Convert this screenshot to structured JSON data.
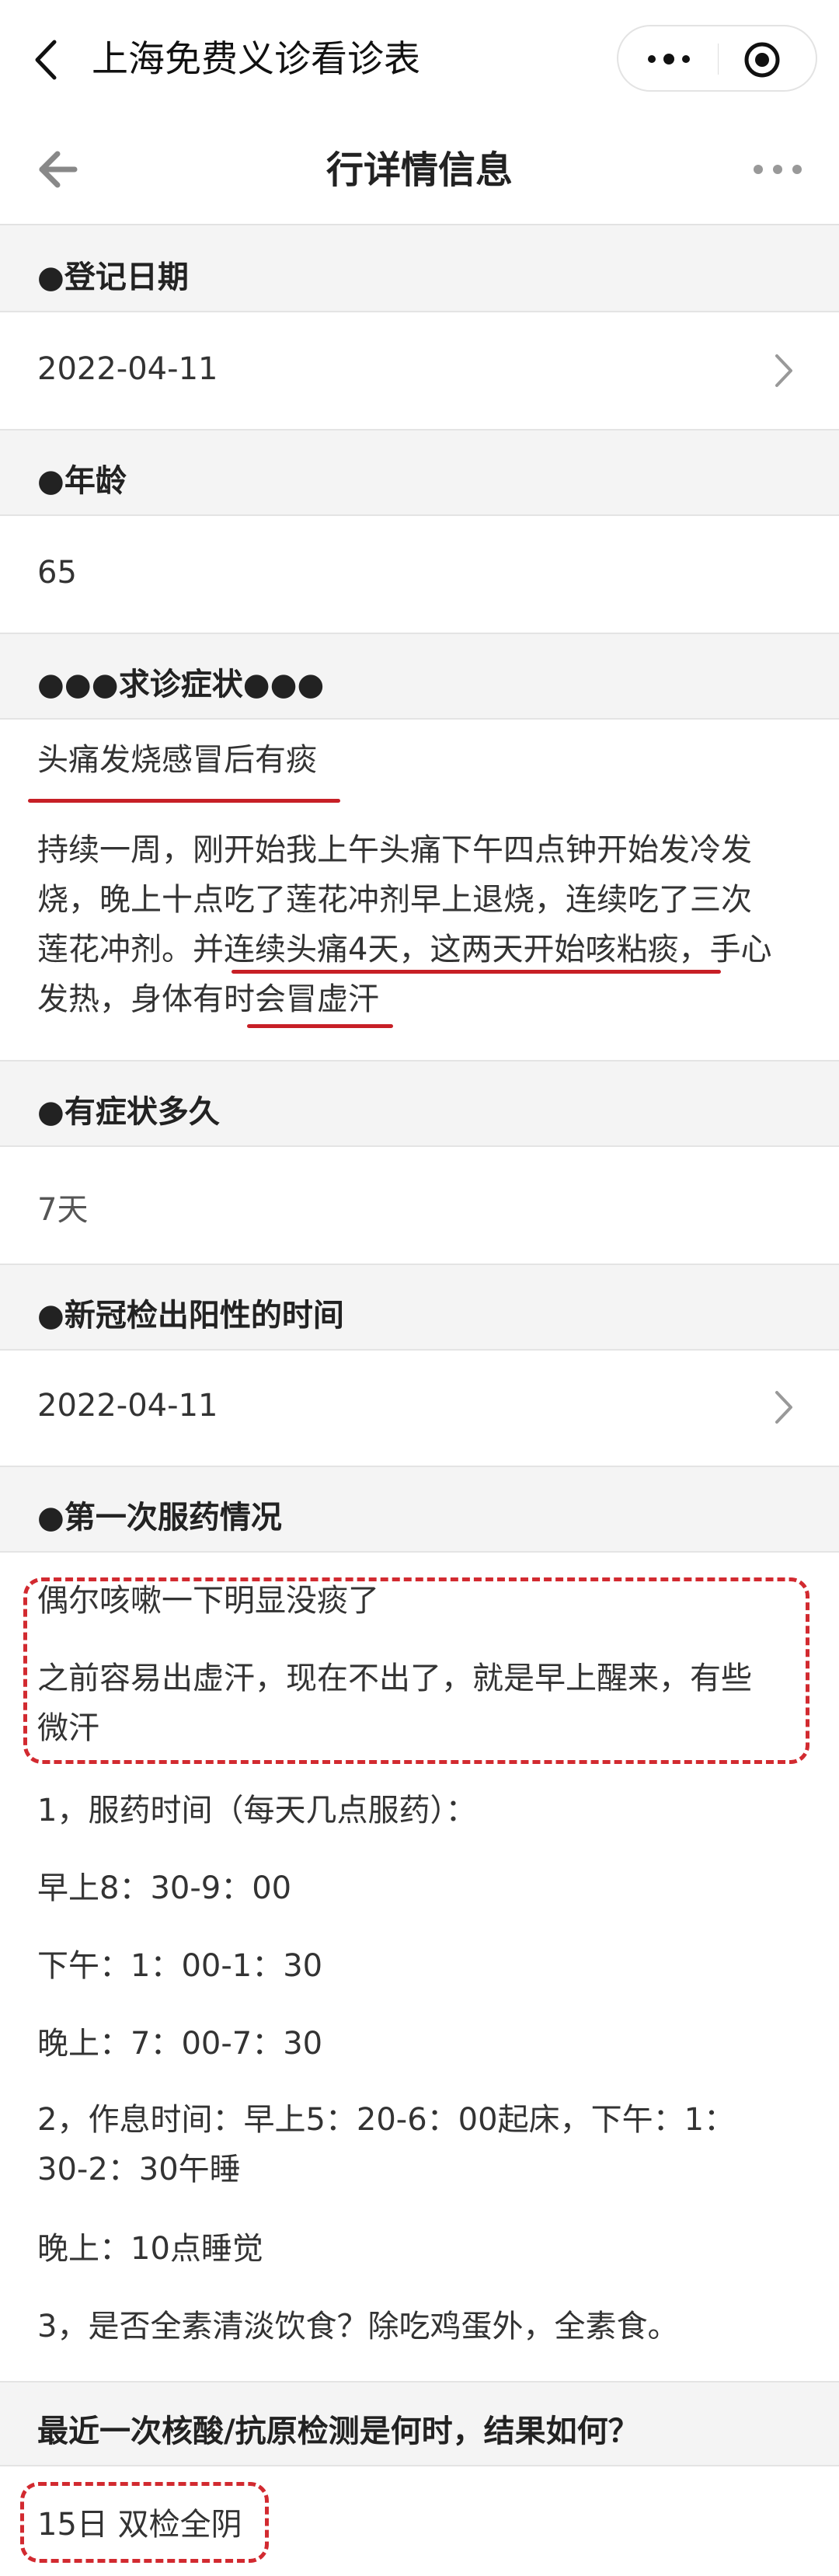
{
  "app": {
    "title": "上海免费义诊看诊表"
  },
  "page": {
    "title": "行详情信息"
  },
  "sections": {
    "reg_date": {
      "label": "●登记日期",
      "value": "2022-04-11"
    },
    "age": {
      "label": "●年龄",
      "value": "65"
    },
    "symptom": {
      "label": "●●●求诊症状●●●",
      "headline": "头痛发烧感冒后有痰",
      "p1": "持续一周，刚开始我上午头痛下午四点钟开始发冷发",
      "p2": "烧，晚上十点吃了莲花冲剂早上退烧，连续吃了三次",
      "p3a": "莲花冲剂。并",
      "p3b": "连续头痛4天，这两天开始咳粘痰，",
      "p3c": "手心",
      "p4a": "发热，身体有",
      "p4b": "时会冒虚汗"
    },
    "duration": {
      "label": "●有症状多久",
      "value": "7天"
    },
    "covid": {
      "label": "●新冠检出阳性的时间",
      "value": "2022-04-11"
    },
    "med": {
      "label": "●第一次服药情况",
      "l1": "偶尔咳嗽一下明显没痰了",
      "l2": "之前容易出虚汗，现在不出了，就是早上醒来，有些",
      "l3": "微汗",
      "l4": "1，服药时间（每天几点服药）：",
      "l5": "早上8：30-9：00",
      "l6": "下午：1：00-1：30",
      "l7": "晚上：7：00-7：30",
      "l8": "2，作息时间：早上5：20-6：00起床，下午：1：",
      "l9": "30-2：30午睡",
      "l10": "晚上：10点睡觉",
      "l11": "3，是否全素清淡饮食？除吃鸡蛋外，全素食。"
    },
    "test": {
      "label": "最近一次核酸/抗原检测是何时，结果如何？",
      "value": "15日 双检全阴"
    }
  },
  "icons": {
    "back": "chevron-left-icon",
    "more": "more-dots-icon",
    "target": "record-target-icon",
    "arrow": "arrow-left-icon",
    "chevron": "chevron-right-icon"
  },
  "colors": {
    "accent_red": "#c71f26"
  }
}
